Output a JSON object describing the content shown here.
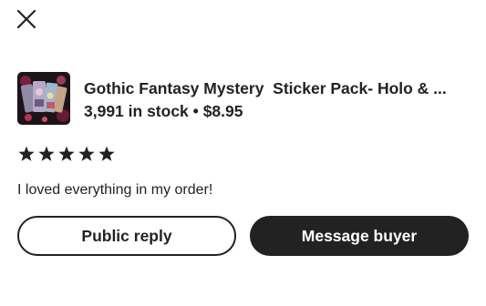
{
  "header": {
    "close_icon": "close-icon"
  },
  "listing": {
    "thumbnail": "sticker-pack-thumbnail",
    "title": "Gothic Fantasy Mystery  Sticker Pack- Holo & ...",
    "stock": "3,991 in stock",
    "separator": "•",
    "price": "$8.95"
  },
  "review": {
    "rating": 5,
    "rating_max": 5,
    "star_icon": "star-icon",
    "text": "I loved everything in my order!"
  },
  "actions": {
    "public_reply_label": "Public reply",
    "message_buyer_label": "Message buyer"
  },
  "colors": {
    "text": "#222222",
    "button_dark": "#222222",
    "background": "#ffffff"
  }
}
